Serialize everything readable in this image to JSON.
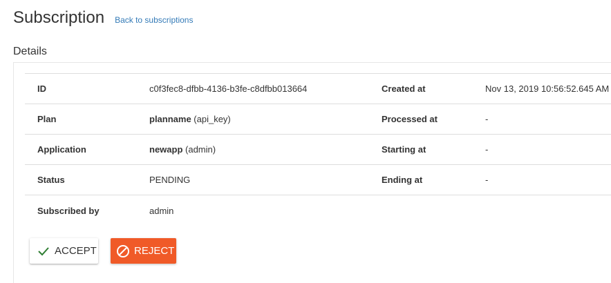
{
  "header": {
    "title": "Subscription",
    "back_link": "Back to subscriptions"
  },
  "details": {
    "section_title": "Details",
    "rows": [
      {
        "label1": "ID",
        "value1": "c0f3fec8-dfbb-4136-b3fe-c8dfbb013664",
        "label2": "Created at",
        "value2": "Nov 13, 2019 10:56:52.645 AM"
      },
      {
        "label1": "Plan",
        "value1_strong": "planname",
        "value1_extra": " (api_key)",
        "label2": "Processed at",
        "value2": "-"
      },
      {
        "label1": "Application",
        "value1_strong": "newapp",
        "value1_extra": " (admin)",
        "label2": "Starting at",
        "value2": "-"
      },
      {
        "label1": "Status",
        "value1": "PENDING",
        "label2": "Ending at",
        "value2": "-"
      },
      {
        "label1": "Subscribed by",
        "value1": "admin"
      }
    ]
  },
  "actions": {
    "accept_label": "ACCEPT",
    "reject_label": "REJECT",
    "accept_icon": "check-icon",
    "reject_icon": "block-icon",
    "accept_icon_color": "#2e7d32",
    "reject_color": "#f05a28"
  }
}
